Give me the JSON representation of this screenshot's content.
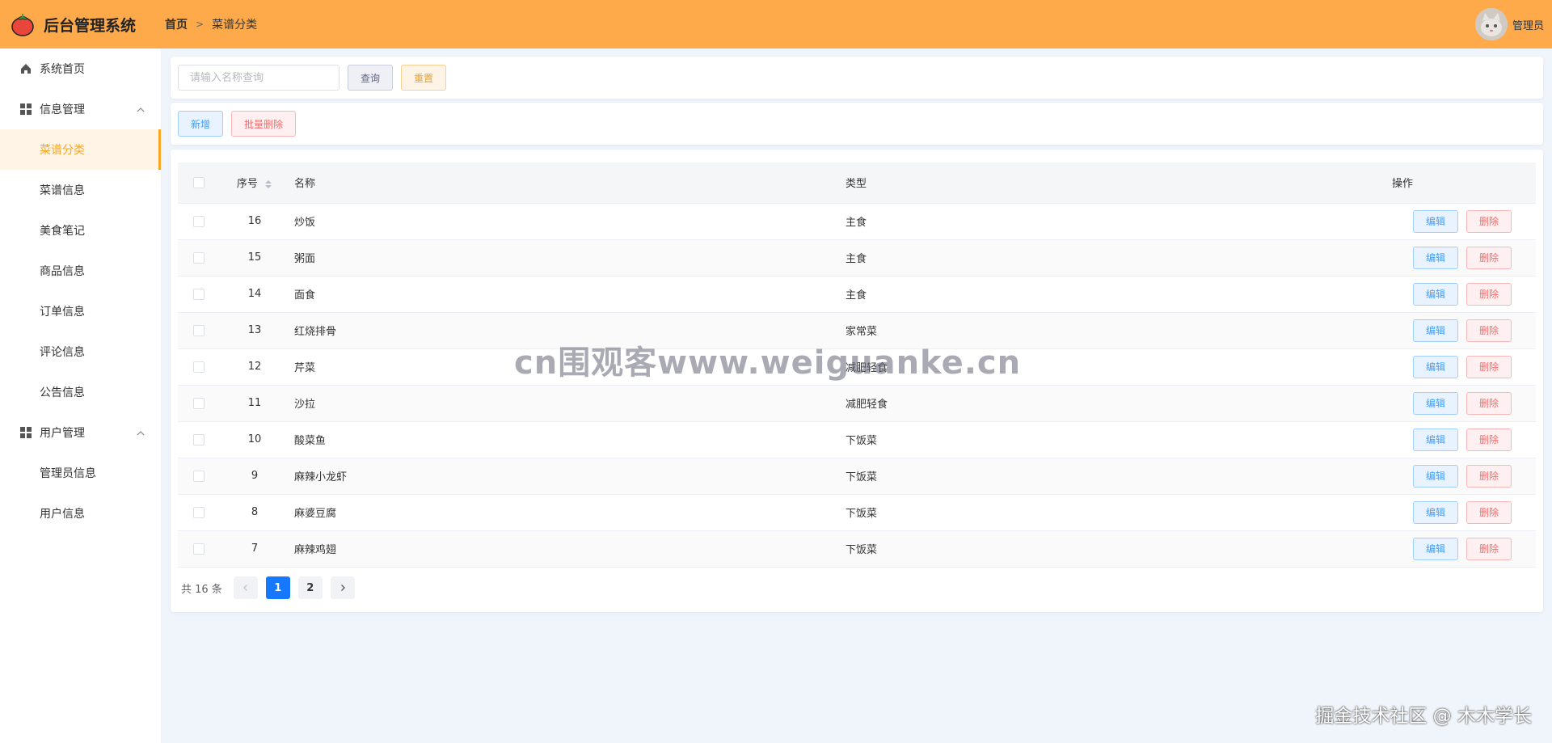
{
  "header": {
    "title": "后台管理系统",
    "breadcrumb_home": "首页",
    "breadcrumb_separator": ">",
    "breadcrumb_current": "菜谱分类",
    "user_name": "管理员",
    "logo_icon": "tomato-icon"
  },
  "sidebar": {
    "home": "系统首页",
    "groups": [
      {
        "label": "信息管理",
        "items": [
          "菜谱分类",
          "菜谱信息",
          "美食笔记",
          "商品信息",
          "订单信息",
          "评论信息",
          "公告信息"
        ]
      },
      {
        "label": "用户管理",
        "items": [
          "管理员信息",
          "用户信息"
        ]
      }
    ],
    "active_item": "菜谱分类"
  },
  "search": {
    "placeholder": "请输入名称查询",
    "value": "",
    "query_label": "查询",
    "reset_label": "重置"
  },
  "actions": {
    "add_label": "新增",
    "batch_delete_label": "批量删除"
  },
  "table": {
    "headers": {
      "index": "序号",
      "name": "名称",
      "type": "类型",
      "ops": "操作"
    },
    "edit_label": "编辑",
    "delete_label": "删除",
    "rows": [
      {
        "id": "16",
        "name": "炒饭",
        "type": "主食"
      },
      {
        "id": "15",
        "name": "粥面",
        "type": "主食"
      },
      {
        "id": "14",
        "name": "面食",
        "type": "主食"
      },
      {
        "id": "13",
        "name": "红烧排骨",
        "type": "家常菜"
      },
      {
        "id": "12",
        "name": "芹菜",
        "type": "减肥轻食"
      },
      {
        "id": "11",
        "name": "沙拉",
        "type": "减肥轻食"
      },
      {
        "id": "10",
        "name": "酸菜鱼",
        "type": "下饭菜"
      },
      {
        "id": "9",
        "name": "麻辣小龙虾",
        "type": "下饭菜"
      },
      {
        "id": "8",
        "name": "麻婆豆腐",
        "type": "下饭菜"
      },
      {
        "id": "7",
        "name": "麻辣鸡翅",
        "type": "下饭菜"
      }
    ]
  },
  "pagination": {
    "total_text": "共 16 条",
    "pages": [
      "1",
      "2"
    ],
    "current_page": "1"
  },
  "watermark": "cn围观客www.weiguanke.cn",
  "credit": "掘金技术社区 @ 木木学长",
  "colors": {
    "header_bg": "#ffaa4a",
    "accent": "#f5a623",
    "primary": "#409eff",
    "danger": "#f56c6c",
    "page_bg": "#f0f4fb"
  }
}
